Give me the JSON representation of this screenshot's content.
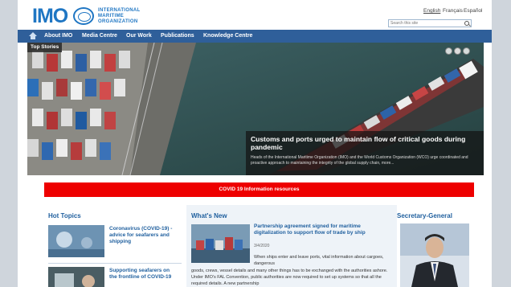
{
  "header": {
    "logo_text": "IMO",
    "logo_lines": [
      "INTERNATIONAL",
      "MARITIME",
      "ORGANIZATION"
    ],
    "languages": [
      "English",
      "Français",
      "Español"
    ],
    "search_placeholder": "Search this site"
  },
  "nav": {
    "items": [
      "About IMO",
      "Media Centre",
      "Our Work",
      "Publications",
      "Knowledge Centre"
    ]
  },
  "hero": {
    "badge": "Top Stories",
    "title": "Customs and ports urged to maintain flow of critical goods during pandemic",
    "description": "Heads of the International Maritime Organization (IMO) and the World Customs Organization (WCO) urge coordinated and proactive approach to maintaining the integrity of the global supply chain, more..."
  },
  "covid": {
    "label": "COVID 19 Information resources"
  },
  "hot_topics": {
    "heading": "Hot Topics",
    "items": [
      {
        "title": "Coronavirus (COVID-19) - advice for seafarers and shipping"
      },
      {
        "title": "Supporting seafarers on the frontline of COVID-19"
      }
    ]
  },
  "whats_new": {
    "heading": "What's New",
    "title": "Partnership agreement signed for maritime digitalization to support flow of trade by ship",
    "date": "3/4/2020",
    "body": "When ships enter and leave ports, vital information about cargoes, dangerous",
    "body_wide": "goods, crews, vessel details and many other things has to be exchanged with the authorities ashore. Under IMO's FAL Convention, public authorities are now required to set up systems so that all the required details. A new partnership"
  },
  "secretary_general": {
    "heading": "Secretary-General"
  },
  "colors": {
    "brand_blue": "#1f76c3",
    "nav_blue": "#2f5f9a",
    "heading_blue": "#1f5f9e",
    "covid_red": "#ee0000"
  }
}
